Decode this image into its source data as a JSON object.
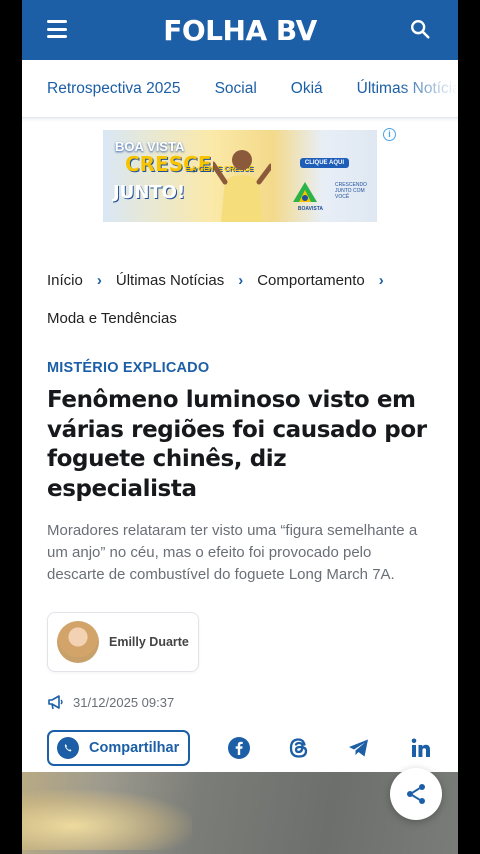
{
  "header": {
    "logo": "FOLHA BV",
    "brand_color": "#1c5fa6"
  },
  "nav": {
    "items": [
      "Retrospectiva 2025",
      "Social",
      "Okiá",
      "Últimas Notícias"
    ]
  },
  "ad": {
    "line1": "BOA VISTA",
    "line2": "CRESCE",
    "line3": "E A GENTE CRESCE",
    "line4": "JUNTO!",
    "button": "CLIQUE AQUI",
    "logo_label": "BOAVISTA",
    "slogan": "CRESCENDO JUNTO COM VOCÊ",
    "info_icon": "info-icon"
  },
  "breadcrumb": [
    "Início",
    "Últimas Notícias",
    "Comportamento",
    "Moda e Tendências"
  ],
  "article": {
    "kicker": "MISTÉRIO EXPLICADO",
    "headline": "Fenômeno luminoso visto em várias regiões foi causado por foguete chinês, diz especialista",
    "summary": "Moradores relataram ter visto uma “figura semelhante a um anjo” no céu, mas o efeito foi provocado pelo descarte de combustível do foguete Long March 7A.",
    "author": "Emilly Duarte",
    "date": "31/12/2025 09:37"
  },
  "share": {
    "label": "Compartilhar",
    "icons": [
      "whatsapp-icon",
      "facebook-icon",
      "threads-icon",
      "telegram-icon",
      "linkedin-icon"
    ]
  },
  "fab": {
    "icon": "share-icon"
  }
}
